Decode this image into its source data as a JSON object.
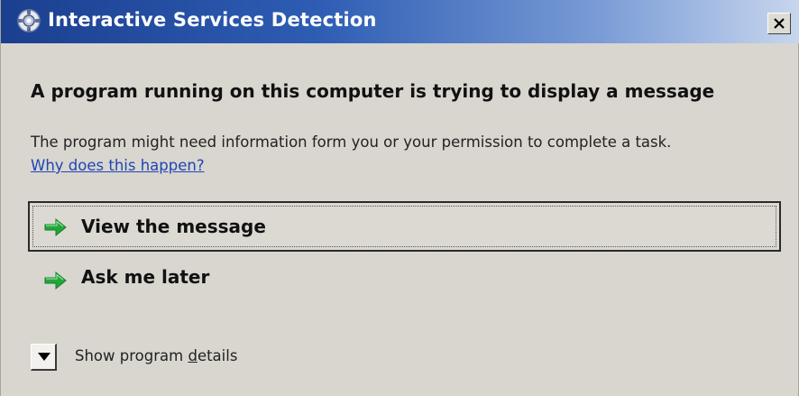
{
  "window": {
    "title": "Interactive Services Detection",
    "close_label": "Close"
  },
  "main": {
    "heading": "A program running on this computer is trying to display a message",
    "description": "The program might need information form you or your permission to complete a task.",
    "help_link": "Why does this happen?"
  },
  "options": {
    "view_message": "View the message",
    "ask_later": "Ask me later"
  },
  "details": {
    "label_prefix": "Show program ",
    "label_access_key": "d",
    "label_suffix": "etails"
  },
  "colors": {
    "accent_arrow": "#22a83a",
    "link": "#1f45b5",
    "titlebar_start": "#1b3f8f",
    "titlebar_end": "#c8d6ee",
    "dialog_bg": "#d9d6cf"
  },
  "icons": {
    "title": "services-gear-icon",
    "close": "close-x-icon",
    "option_arrow": "green-arrow-right-icon",
    "expand": "triangle-down-icon"
  }
}
